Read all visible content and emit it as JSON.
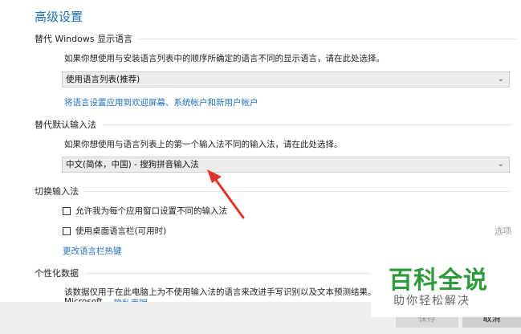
{
  "page": {
    "title": "高级设置"
  },
  "display_language": {
    "heading": "替代 Windows 显示语言",
    "description": "如果你想使用与安装语言列表中的顺序所确定的语言不同的显示语言，请在此处选择。",
    "selected": "使用语言列表(推荐)",
    "apply_link": "将语言设置应用到欢迎屏幕、系统帐户和新用户帐户"
  },
  "input_method": {
    "heading": "替代默认输入法",
    "description": "如果你想使用与语言列表上的第一个输入法不同的输入法，请在此处选择。",
    "selected": "中文(简体，中国) - 搜狗拼音输入法"
  },
  "switch_input": {
    "heading": "切换输入法",
    "checkbox1": "允许我为每个应用窗口设置不同的输入法",
    "checkbox2": "使用桌面语言栏(可用时)",
    "options_label": "选项",
    "hotkey_link": "更改语言栏热键"
  },
  "personalization": {
    "heading": "个性化数据",
    "description": "该数据仅用于在此电脑上为不使用输入法的语言来改进手写识别以及文本预测结果。",
    "partial_text": "Microsoft",
    "partial_link": "隐私声明"
  },
  "watermark": {
    "title": "百科全说",
    "subtitle": "助你轻松解决"
  },
  "footer": {
    "save_label": "保存",
    "cancel_label": "取消"
  },
  "colors": {
    "accent": "#1a6fb5",
    "arrow": "#e0352b",
    "watermark": "#2d9b3a"
  }
}
